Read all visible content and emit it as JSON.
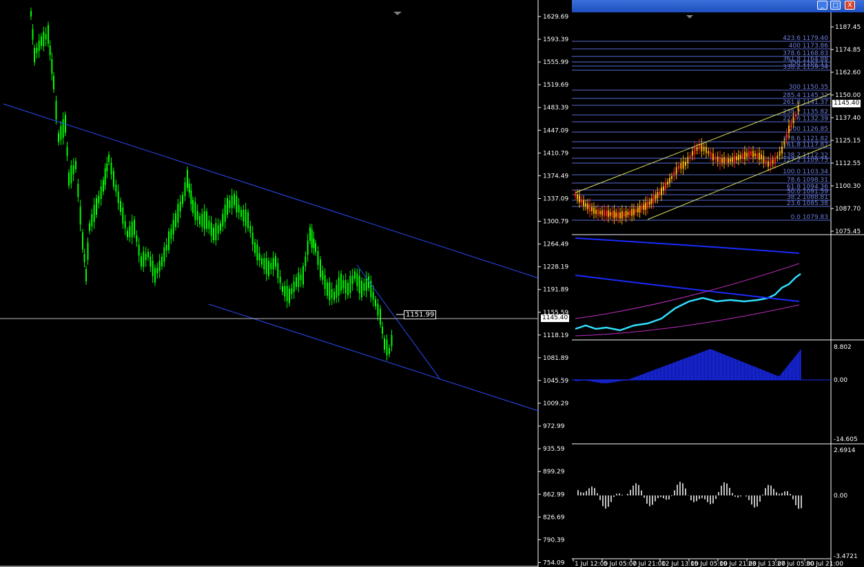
{
  "left_chart": {
    "price_axis": [
      "1629.69",
      "1593.39",
      "1555.99",
      "1519.69",
      "1483.39",
      "1447.09",
      "1410.79",
      "1374.49",
      "1337.09",
      "1300.79",
      "1264.49",
      "1228.19",
      "1191.89",
      "1155.59",
      "1118.19",
      "1081.89",
      "1045.59",
      "1009.29",
      "972.99",
      "935.59",
      "899.29",
      "862.99",
      "826.69",
      "790.39",
      "754.09"
    ],
    "current_price": "1145.40",
    "marker_label": "1151.99",
    "colors": {
      "candles": "#00ff00",
      "trend": "#2b4cff",
      "gridline": "#ffffff"
    }
  },
  "right_chart": {
    "price_axis": [
      "1187.45",
      "1174.85",
      "1162.60",
      "1150.00",
      "1137.40",
      "1125.15",
      "1112.55",
      "1100.30",
      "1087.70",
      "1075.45"
    ],
    "current_price": "1145.40",
    "fib_levels": [
      "423.6 1179.40",
      "400 1173.86",
      "378.6 1168.83",
      "361.8 1164.88",
      "350 1162.11",
      "338.2 1159.34",
      "300 1150.35",
      "285.4 1145.32",
      "261.8 1141.37",
      "238.2 1135.82",
      "223.6 1132.39",
      "200 1126.85",
      "178.6 1121.82",
      "161.8 1117.87",
      "138.2 1112.32",
      "127.2 1109.73",
      "100.0 1103.34",
      "78.6 1098.31",
      "61.8 1094.36",
      "50.0 1091.59",
      "38.2 1088.81",
      "23.6 1085.38",
      "0.0 1079.83"
    ],
    "macd_axis": [
      "8.802",
      "0.00",
      "-14.605"
    ],
    "hist_axis": [
      "2.6914",
      "0.00",
      "-3.4721"
    ],
    "time_axis": [
      "1 Jul 12:00",
      "5 Jul 05:00",
      "7 Jul 21:00",
      "12 Jul 13:00",
      "15 Jul 05:00",
      "19 Jul 21:00",
      "23 Jul 13:00",
      "27 Jul 05:00",
      "30 Jul 21:00"
    ],
    "colors": {
      "bull": "#ffb000",
      "bear": "#ff2020",
      "fib": "#5a6ed8",
      "channel": "#e0e060",
      "ma": "#1a2bff",
      "rsi": "#30e0ff",
      "bands": "#c030c0",
      "macd": "#1a2bff",
      "hist": "#c0c0c0"
    }
  },
  "window": {
    "buttons": [
      "_",
      "□",
      "X"
    ]
  }
}
